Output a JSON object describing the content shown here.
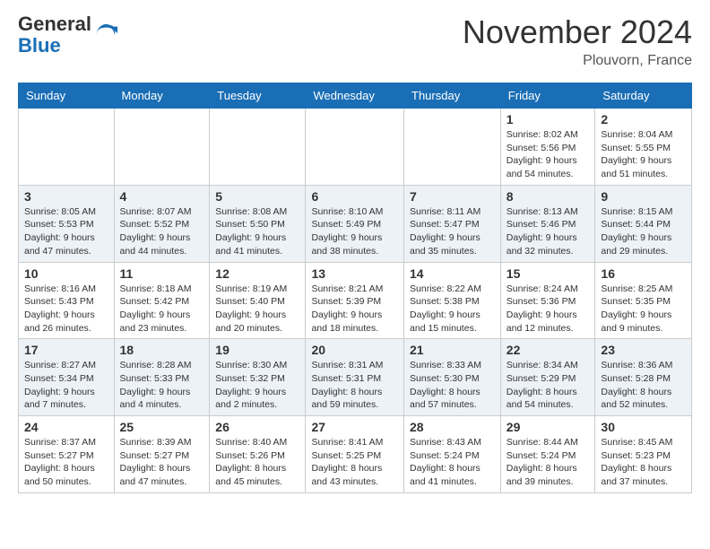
{
  "logo": {
    "general": "General",
    "blue": "Blue"
  },
  "title": "November 2024",
  "location": "Plouvorn, France",
  "headers": [
    "Sunday",
    "Monday",
    "Tuesday",
    "Wednesday",
    "Thursday",
    "Friday",
    "Saturday"
  ],
  "rows": [
    [
      {
        "day": "",
        "info": ""
      },
      {
        "day": "",
        "info": ""
      },
      {
        "day": "",
        "info": ""
      },
      {
        "day": "",
        "info": ""
      },
      {
        "day": "",
        "info": ""
      },
      {
        "day": "1",
        "info": "Sunrise: 8:02 AM\nSunset: 5:56 PM\nDaylight: 9 hours and 54 minutes."
      },
      {
        "day": "2",
        "info": "Sunrise: 8:04 AM\nSunset: 5:55 PM\nDaylight: 9 hours and 51 minutes."
      }
    ],
    [
      {
        "day": "3",
        "info": "Sunrise: 8:05 AM\nSunset: 5:53 PM\nDaylight: 9 hours and 47 minutes."
      },
      {
        "day": "4",
        "info": "Sunrise: 8:07 AM\nSunset: 5:52 PM\nDaylight: 9 hours and 44 minutes."
      },
      {
        "day": "5",
        "info": "Sunrise: 8:08 AM\nSunset: 5:50 PM\nDaylight: 9 hours and 41 minutes."
      },
      {
        "day": "6",
        "info": "Sunrise: 8:10 AM\nSunset: 5:49 PM\nDaylight: 9 hours and 38 minutes."
      },
      {
        "day": "7",
        "info": "Sunrise: 8:11 AM\nSunset: 5:47 PM\nDaylight: 9 hours and 35 minutes."
      },
      {
        "day": "8",
        "info": "Sunrise: 8:13 AM\nSunset: 5:46 PM\nDaylight: 9 hours and 32 minutes."
      },
      {
        "day": "9",
        "info": "Sunrise: 8:15 AM\nSunset: 5:44 PM\nDaylight: 9 hours and 29 minutes."
      }
    ],
    [
      {
        "day": "10",
        "info": "Sunrise: 8:16 AM\nSunset: 5:43 PM\nDaylight: 9 hours and 26 minutes."
      },
      {
        "day": "11",
        "info": "Sunrise: 8:18 AM\nSunset: 5:42 PM\nDaylight: 9 hours and 23 minutes."
      },
      {
        "day": "12",
        "info": "Sunrise: 8:19 AM\nSunset: 5:40 PM\nDaylight: 9 hours and 20 minutes."
      },
      {
        "day": "13",
        "info": "Sunrise: 8:21 AM\nSunset: 5:39 PM\nDaylight: 9 hours and 18 minutes."
      },
      {
        "day": "14",
        "info": "Sunrise: 8:22 AM\nSunset: 5:38 PM\nDaylight: 9 hours and 15 minutes."
      },
      {
        "day": "15",
        "info": "Sunrise: 8:24 AM\nSunset: 5:36 PM\nDaylight: 9 hours and 12 minutes."
      },
      {
        "day": "16",
        "info": "Sunrise: 8:25 AM\nSunset: 5:35 PM\nDaylight: 9 hours and 9 minutes."
      }
    ],
    [
      {
        "day": "17",
        "info": "Sunrise: 8:27 AM\nSunset: 5:34 PM\nDaylight: 9 hours and 7 minutes."
      },
      {
        "day": "18",
        "info": "Sunrise: 8:28 AM\nSunset: 5:33 PM\nDaylight: 9 hours and 4 minutes."
      },
      {
        "day": "19",
        "info": "Sunrise: 8:30 AM\nSunset: 5:32 PM\nDaylight: 9 hours and 2 minutes."
      },
      {
        "day": "20",
        "info": "Sunrise: 8:31 AM\nSunset: 5:31 PM\nDaylight: 8 hours and 59 minutes."
      },
      {
        "day": "21",
        "info": "Sunrise: 8:33 AM\nSunset: 5:30 PM\nDaylight: 8 hours and 57 minutes."
      },
      {
        "day": "22",
        "info": "Sunrise: 8:34 AM\nSunset: 5:29 PM\nDaylight: 8 hours and 54 minutes."
      },
      {
        "day": "23",
        "info": "Sunrise: 8:36 AM\nSunset: 5:28 PM\nDaylight: 8 hours and 52 minutes."
      }
    ],
    [
      {
        "day": "24",
        "info": "Sunrise: 8:37 AM\nSunset: 5:27 PM\nDaylight: 8 hours and 50 minutes."
      },
      {
        "day": "25",
        "info": "Sunrise: 8:39 AM\nSunset: 5:27 PM\nDaylight: 8 hours and 47 minutes."
      },
      {
        "day": "26",
        "info": "Sunrise: 8:40 AM\nSunset: 5:26 PM\nDaylight: 8 hours and 45 minutes."
      },
      {
        "day": "27",
        "info": "Sunrise: 8:41 AM\nSunset: 5:25 PM\nDaylight: 8 hours and 43 minutes."
      },
      {
        "day": "28",
        "info": "Sunrise: 8:43 AM\nSunset: 5:24 PM\nDaylight: 8 hours and 41 minutes."
      },
      {
        "day": "29",
        "info": "Sunrise: 8:44 AM\nSunset: 5:24 PM\nDaylight: 8 hours and 39 minutes."
      },
      {
        "day": "30",
        "info": "Sunrise: 8:45 AM\nSunset: 5:23 PM\nDaylight: 8 hours and 37 minutes."
      }
    ]
  ]
}
